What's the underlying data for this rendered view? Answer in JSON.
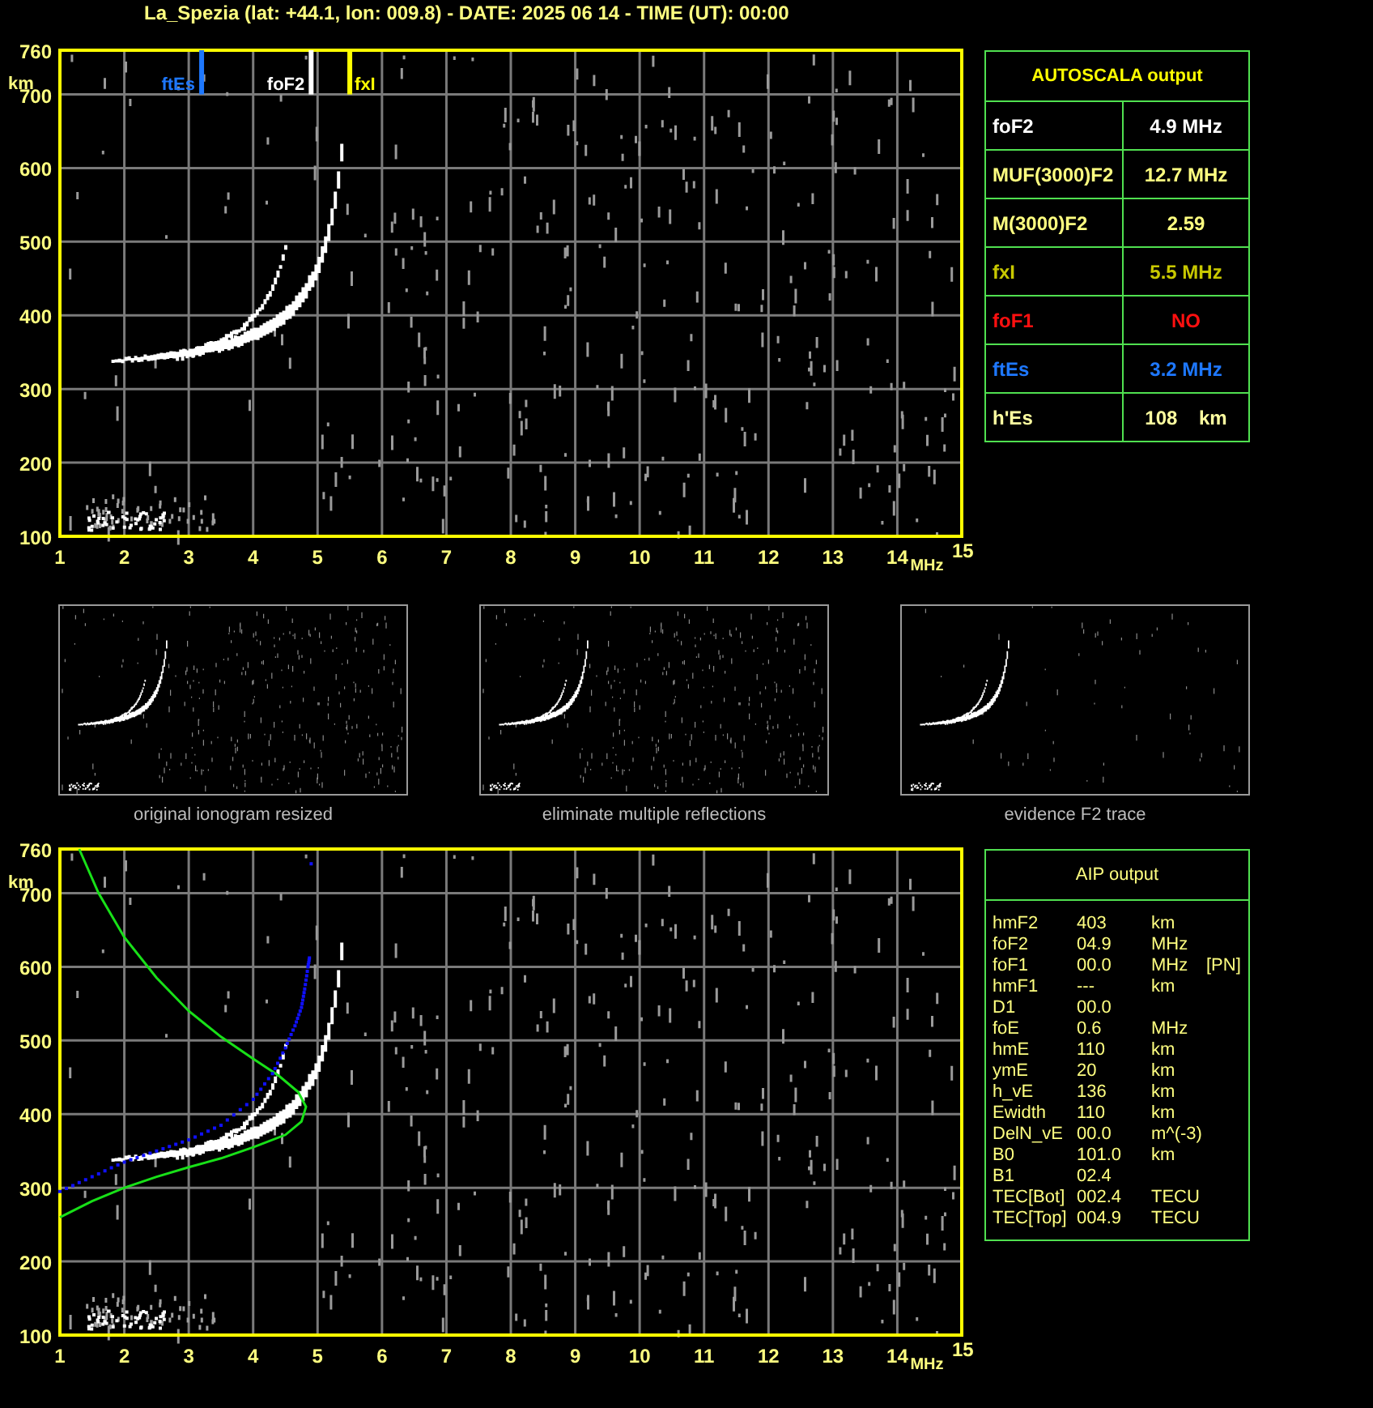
{
  "title": "La_Spezia (lat: +44.1, lon: 009.8) - DATE: 2025 06 14 - TIME (UT): 00:00",
  "top_ionogram": {
    "y_unit": "km",
    "x_unit": "MHz",
    "x_ticks": [
      "1",
      "2",
      "3",
      "4",
      "5",
      "6",
      "7",
      "8",
      "9",
      "10",
      "11",
      "12",
      "13",
      "14",
      "15"
    ],
    "y_ticks": [
      "760",
      "700",
      "600",
      "500",
      "400",
      "300",
      "200",
      "100"
    ],
    "markers": [
      {
        "label": "ftEs",
        "color": "#1e78ff"
      },
      {
        "label": "foF2",
        "color": "#ffffff"
      },
      {
        "label": "fxI",
        "color": "#ffff00"
      }
    ]
  },
  "autoscala": {
    "title": "AUTOSCALA output",
    "rows": [
      {
        "label": "foF2",
        "value": "4.9 MHz",
        "color": "#ffffff"
      },
      {
        "label": "MUF(3000)F2",
        "value": "12.7 MHz",
        "color": "#ffff80"
      },
      {
        "label": "M(3000)F2",
        "value": "2.59",
        "color": "#ffff80"
      },
      {
        "label": "fxI",
        "value": "5.5 MHz",
        "color": "#c8c800"
      },
      {
        "label": "foF1",
        "value": "NO",
        "color": "#ff1010"
      },
      {
        "label": "ftEs",
        "value": "3.2 MHz",
        "color": "#1e78ff"
      },
      {
        "label": "h'Es",
        "value": "108    km",
        "color": "#ffffa0"
      }
    ]
  },
  "thumbnails": [
    {
      "caption": "original ionogram resized"
    },
    {
      "caption": "eliminate multiple reflections"
    },
    {
      "caption": "evidence F2 trace"
    }
  ],
  "bottom_ionogram": {
    "y_unit": "km",
    "x_unit": "MHz",
    "x_ticks": [
      "1",
      "2",
      "3",
      "4",
      "5",
      "6",
      "7",
      "8",
      "9",
      "10",
      "11",
      "12",
      "13",
      "14",
      "15"
    ],
    "y_ticks": [
      "760",
      "700",
      "600",
      "500",
      "400",
      "300",
      "200",
      "100"
    ]
  },
  "aip": {
    "title": "AIP output",
    "rows": [
      {
        "name": "hmF2",
        "value": "403",
        "unit": "km"
      },
      {
        "name": "foF2",
        "value": "04.9",
        "unit": "MHz"
      },
      {
        "name": "foF1",
        "value": "00.0",
        "unit": "MHz",
        "note": "[PN]"
      },
      {
        "name": "hmF1",
        "value": "---",
        "unit": "km"
      },
      {
        "name": "D1",
        "value": "00.0"
      },
      {
        "name": "foE",
        "value": "0.6",
        "unit": "MHz"
      },
      {
        "name": "hmE",
        "value": "110",
        "unit": "km"
      },
      {
        "name": "ymE",
        "value": "20",
        "unit": "km"
      },
      {
        "name": "h_vE",
        "value": "136",
        "unit": "km"
      },
      {
        "name": "Ewidth",
        "value": "110",
        "unit": "km"
      },
      {
        "name": "DelN_vE",
        "value": "00.0",
        "unit": "m^(-3)"
      },
      {
        "name": "B0",
        "value": "101.0",
        "unit": "km"
      },
      {
        "name": "B1",
        "value": "02.4"
      },
      {
        "name": "TEC[Bot]",
        "value": "002.4",
        "unit": "TECU"
      },
      {
        "name": "TEC[Top]",
        "value": "004.9",
        "unit": "TECU"
      }
    ]
  }
}
